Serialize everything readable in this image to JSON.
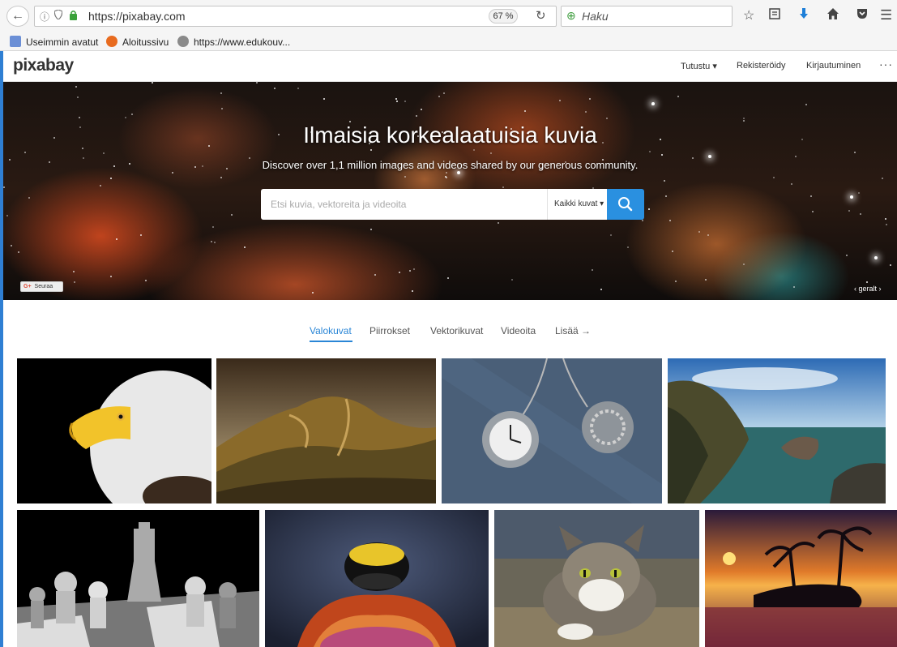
{
  "browser": {
    "url": "https://pixabay.com",
    "zoom": "67 %",
    "search_placeholder": "Haku",
    "bookmarks": [
      {
        "label": "Useimmin avatut"
      },
      {
        "label": "Aloitussivu"
      },
      {
        "label": "https://www.edukouv..."
      }
    ]
  },
  "site": {
    "logo": "pixabay",
    "nav": [
      {
        "label": "Tutustu ▾"
      },
      {
        "label": "Rekisteröidy"
      },
      {
        "label": "Kirjautuminen"
      },
      {
        "label": "···"
      }
    ]
  },
  "hero": {
    "title": "Ilmaisia korkealaatuisia kuvia",
    "subtitle": "Discover over 1,1 million images and videos shared by our generous community.",
    "search_placeholder": "Etsi kuvia, vektoreita ja videoita",
    "filter_label": "Kaikki kuvat ▾",
    "follow_label": "Seuraa",
    "follow_prefix": "G+",
    "credit": "‹  geralt  ›"
  },
  "tabs": [
    {
      "label": "Valokuvat",
      "active": true
    },
    {
      "label": "Piirrokset",
      "active": false
    },
    {
      "label": "Vektorikuvat",
      "active": false
    },
    {
      "label": "Videoita",
      "active": false
    },
    {
      "label": "Lisää →",
      "active": false
    }
  ],
  "photos": [
    {
      "subject": "bald eagle"
    },
    {
      "subject": "hills landscape"
    },
    {
      "subject": "pocket watches"
    },
    {
      "subject": "coastal cliffs"
    },
    {
      "subject": "chess pieces"
    },
    {
      "subject": "bumblebee"
    },
    {
      "subject": "tabby cat"
    },
    {
      "subject": "tropical sunset"
    }
  ],
  "colors": {
    "accent": "#2a86d6",
    "search_button": "#2a90e0"
  }
}
